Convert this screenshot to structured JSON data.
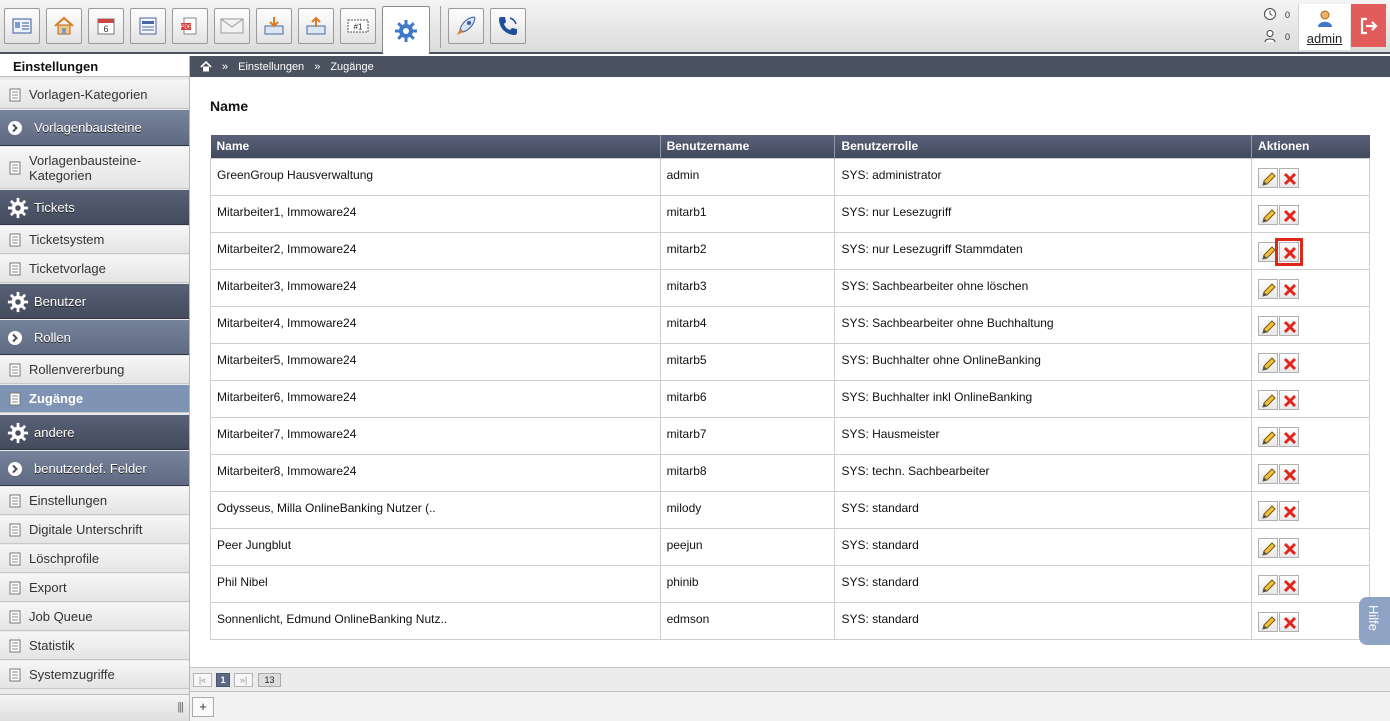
{
  "toolbar": {
    "buttons": [
      {
        "name": "contacts-icon"
      },
      {
        "name": "home-icon"
      },
      {
        "name": "calendar-icon",
        "label": "6"
      },
      {
        "name": "ledger-icon"
      },
      {
        "name": "pdf-document-icon"
      },
      {
        "name": "mail-icon"
      },
      {
        "name": "inbox-download-icon"
      },
      {
        "name": "outbox-upload-icon"
      },
      {
        "name": "ticket-icon",
        "label": "#1"
      },
      {
        "name": "settings-gear-icon",
        "active": true
      },
      {
        "name": "rocket-icon"
      },
      {
        "name": "phone-icon"
      }
    ],
    "notifications": [
      {
        "icon": "clock-icon",
        "count": "0"
      },
      {
        "icon": "user-clock-icon",
        "count": "0"
      }
    ],
    "user": {
      "name": "admin"
    },
    "logout_icon": "logout-icon"
  },
  "sidebar": {
    "title": "Einstellungen",
    "items": [
      {
        "type": "link",
        "label": "Vorlagen-Kategorien"
      },
      {
        "type": "group",
        "label": "Vorlagenbausteine",
        "icon": "arrow-circle-icon"
      },
      {
        "type": "link",
        "label": "Vorlagenbausteine-Kategorien"
      },
      {
        "type": "group",
        "label": "Tickets",
        "icon": "gear-icon"
      },
      {
        "type": "link",
        "label": "Ticketsystem"
      },
      {
        "type": "link",
        "label": "Ticketvorlage"
      },
      {
        "type": "group",
        "label": "Benutzer",
        "icon": "gear-icon"
      },
      {
        "type": "group",
        "label": "Rollen",
        "icon": "arrow-circle-icon"
      },
      {
        "type": "link",
        "label": "Rollenvererbung"
      },
      {
        "type": "link",
        "label": "Zugänge",
        "active": true
      },
      {
        "type": "group",
        "label": "andere",
        "icon": "gear-icon"
      },
      {
        "type": "group",
        "label": "benutzerdef. Felder",
        "icon": "arrow-circle-icon"
      },
      {
        "type": "link",
        "label": "Einstellungen"
      },
      {
        "type": "link",
        "label": "Digitale Unterschrift"
      },
      {
        "type": "link",
        "label": "Löschprofile"
      },
      {
        "type": "link",
        "label": "Export"
      },
      {
        "type": "link",
        "label": "Job Queue"
      },
      {
        "type": "link",
        "label": "Statistik"
      },
      {
        "type": "link",
        "label": "Systemzugriffe"
      }
    ],
    "footer_grip": "|||"
  },
  "breadcrumb": {
    "separator": "»",
    "items": [
      "Einstellungen",
      "Zugänge"
    ]
  },
  "main": {
    "heading": "Name",
    "table": {
      "columns": [
        "Name",
        "Benutzername",
        "Benutzerrolle",
        "Aktionen"
      ],
      "rows": [
        {
          "name": "GreenGroup Hausverwaltung",
          "user": "admin",
          "role": "SYS: administrator"
        },
        {
          "name": "Mitarbeiter1, Immoware24",
          "user": "mitarb1",
          "role": "SYS: nur Lesezugriff"
        },
        {
          "name": "Mitarbeiter2, Immoware24",
          "user": "mitarb2",
          "role": "SYS: nur Lesezugriff Stammdaten",
          "highlight_delete": true
        },
        {
          "name": "Mitarbeiter3, Immoware24",
          "user": "mitarb3",
          "role": "SYS: Sachbearbeiter ohne löschen"
        },
        {
          "name": "Mitarbeiter4, Immoware24",
          "user": "mitarb4",
          "role": "SYS: Sachbearbeiter ohne Buchhaltung"
        },
        {
          "name": "Mitarbeiter5, Immoware24",
          "user": "mitarb5",
          "role": "SYS: Buchhalter ohne OnlineBanking"
        },
        {
          "name": "Mitarbeiter6, Immoware24",
          "user": "mitarb6",
          "role": "SYS: Buchhalter inkl OnlineBanking"
        },
        {
          "name": "Mitarbeiter7, Immoware24",
          "user": "mitarb7",
          "role": "SYS: Hausmeister"
        },
        {
          "name": "Mitarbeiter8, Immoware24",
          "user": "mitarb8",
          "role": "SYS: techn. Sachbearbeiter"
        },
        {
          "name": "Odysseus, Milla OnlineBanking Nutzer (..",
          "user": "milody",
          "role": "SYS: standard"
        },
        {
          "name": "Peer Jungblut",
          "user": "peejun",
          "role": "SYS: standard"
        },
        {
          "name": "Phil Nibel",
          "user": "phinib",
          "role": "SYS: standard"
        },
        {
          "name": "Sonnenlicht, Edmund OnlineBanking Nutz..",
          "user": "edmson",
          "role": "SYS: standard"
        }
      ],
      "actions": [
        "edit-pencil-icon",
        "delete-x-icon"
      ]
    }
  },
  "pager": {
    "first": "|«",
    "current": "1",
    "last": "»|",
    "total": "13"
  },
  "bottom": {
    "add_label": "+"
  },
  "help": {
    "label": "Hilfe"
  },
  "colors": {
    "header_dark": "#4a5260",
    "active_blue": "#7f94b4",
    "delete_red": "#e0251b",
    "logout_red": "#e25c5c"
  }
}
